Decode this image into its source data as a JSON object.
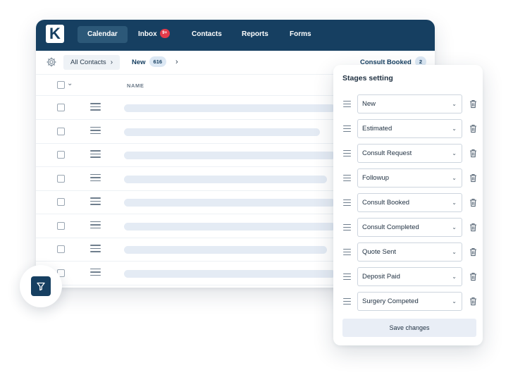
{
  "brand": {
    "logo_letter": "K"
  },
  "nav": {
    "items": [
      {
        "label": "Calendar",
        "active": true
      },
      {
        "label": "Inbox",
        "badge": "9+"
      },
      {
        "label": "Contacts"
      },
      {
        "label": "Reports"
      },
      {
        "label": "Forms"
      }
    ]
  },
  "toolbar": {
    "settings_icon": "gear-icon",
    "breadcrumb": "All Contacts",
    "current_stage": {
      "label": "New",
      "count": "616"
    },
    "other_stage": {
      "label": "Consult Booked",
      "count": "2"
    }
  },
  "table": {
    "columns": [
      "NAME"
    ],
    "row_count": 8
  },
  "filter_button": {
    "icon": "filter-icon"
  },
  "stages_panel": {
    "title": "Stages setting",
    "stages": [
      "New",
      "Estimated",
      "Consult Request",
      "Followup",
      "Consult Booked",
      "Consult Completed",
      "Quote Sent",
      "Deposit Paid",
      "Surgery Competed"
    ],
    "save_label": "Save changes"
  },
  "colors": {
    "nav_bg": "#163f61",
    "accent": "#163f61",
    "badge": "#e23a4a",
    "skeleton": "#e4ebf4",
    "save_bg": "#e9eef6"
  }
}
